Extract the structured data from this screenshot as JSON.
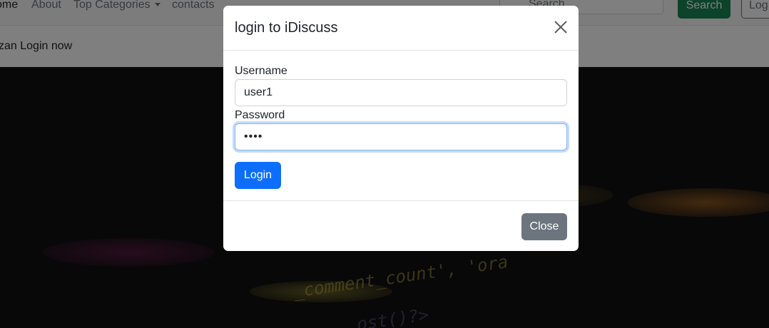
{
  "navbar": {
    "links": [
      "ome",
      "About",
      "Top Categories",
      "contacts"
    ],
    "search_placeholder": "Search",
    "search_button": "Search",
    "login_button": "Log"
  },
  "welcome": {
    "text": "zan Login now"
  },
  "hero": {
    "code_lines": [
      "_comment_count', 'ora",
      "ost()?>"
    ]
  },
  "modal": {
    "title": "login to iDiscuss",
    "close_icon": "close-icon",
    "username_label": "Username",
    "username_value": "user1",
    "password_label": "Password",
    "password_value": "••••",
    "submit_label": "Login",
    "close_label": "Close"
  },
  "colors": {
    "primary": "#0d6efd",
    "secondary": "#6c757d",
    "success": "#198754",
    "focus_border": "#86b7fe"
  }
}
